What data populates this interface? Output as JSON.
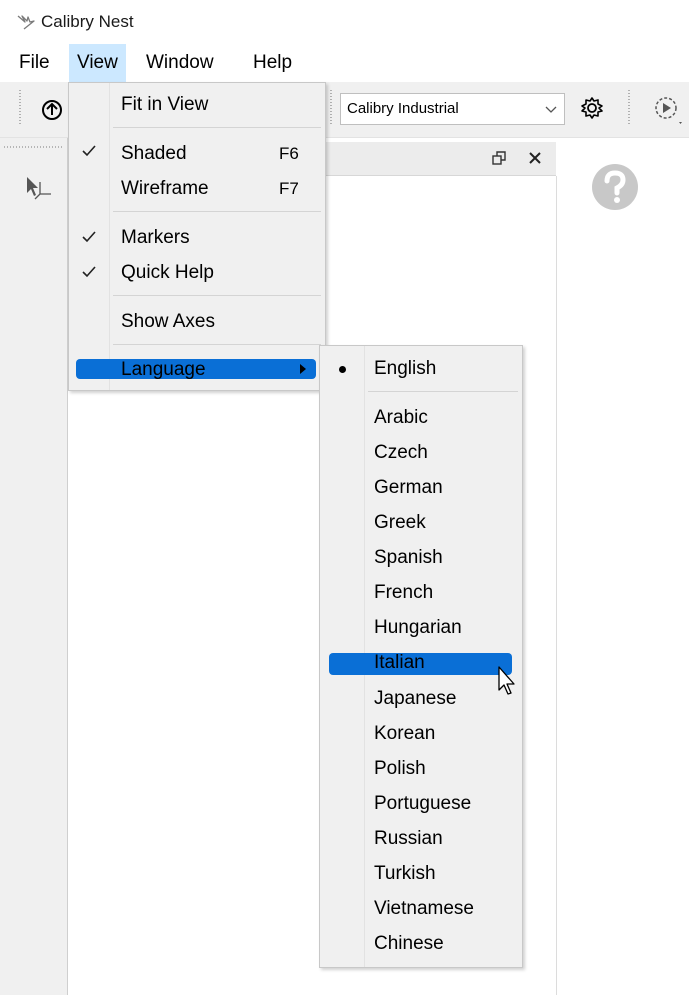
{
  "window": {
    "title": "Calibry Nest",
    "app_icon": "bird-icon"
  },
  "menubar": {
    "items": [
      "File",
      "View",
      "Window",
      "Help"
    ],
    "open_menu": "View"
  },
  "toolbar": {
    "icons": [
      "upload-icon",
      "settings-gear-icon",
      "play-circle-icon"
    ],
    "profile_select": {
      "value": "Calibry Industrial"
    }
  },
  "left_panel": {
    "icons": [
      "select-cursor-axes-icon"
    ]
  },
  "dock": {
    "icons": [
      "restore-window-icon",
      "close-icon"
    ]
  },
  "help": {
    "icon": "question-circle-icon"
  },
  "view_menu": {
    "fit_in_view": "Fit in View",
    "shaded": "Shaded",
    "shaded_shortcut": "F6",
    "shaded_checked": true,
    "wireframe": "Wireframe",
    "wireframe_shortcut": "F7",
    "markers": "Markers",
    "markers_checked": true,
    "quick_help": "Quick Help",
    "quick_help_checked": true,
    "show_axes": "Show Axes",
    "language": "Language"
  },
  "language_menu": {
    "current": "English",
    "highlighted": "Italian",
    "items": [
      "Arabic",
      "Czech",
      "German",
      "Greek",
      "Spanish",
      "French",
      "Hungarian",
      "Italian",
      "Japanese",
      "Korean",
      "Polish",
      "Portuguese",
      "Russian",
      "Turkish",
      "Vietnamese",
      "Chinese"
    ]
  },
  "colors": {
    "highlight": "#0a6fd6",
    "menu_bg": "#f0f0f0",
    "help_icon": "#c8c8c8"
  }
}
